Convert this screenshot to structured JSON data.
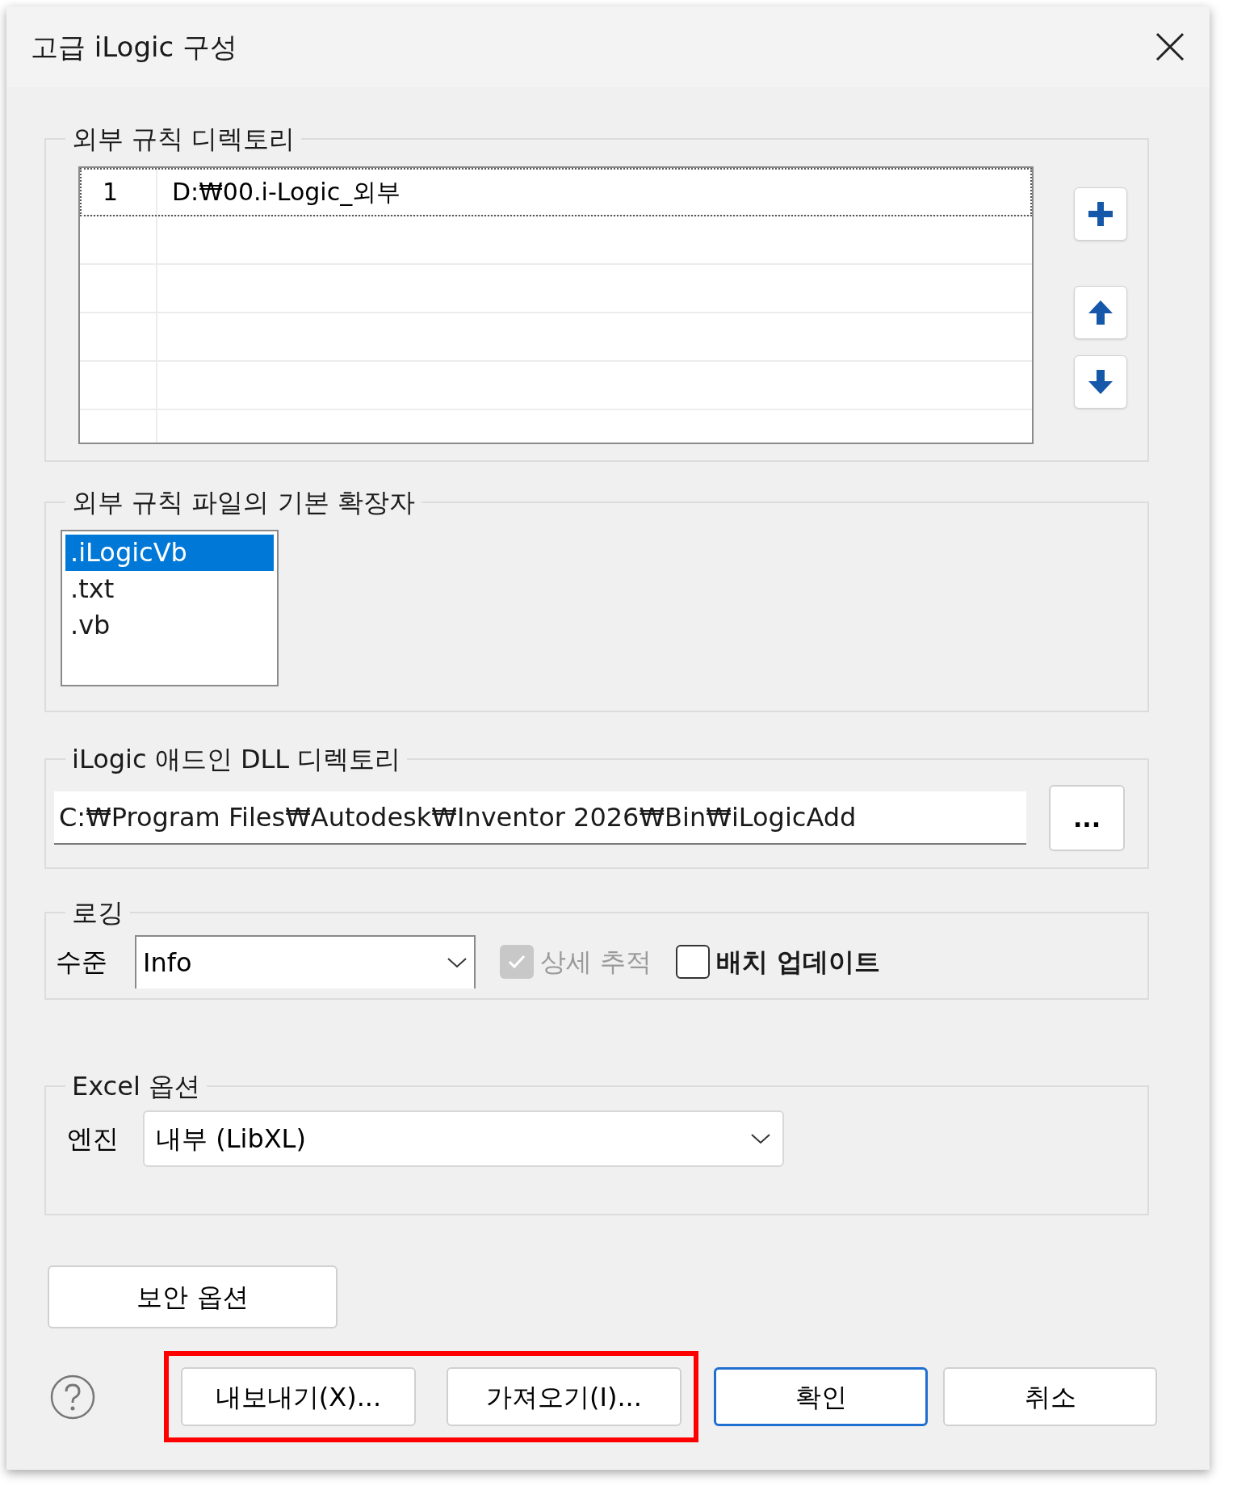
{
  "window": {
    "title": "고급 iLogic 구성"
  },
  "rules_directory": {
    "title": "외부 규칙 디렉토리",
    "rows": [
      {
        "index": "1",
        "path": "D:₩00.i-Logic_외부",
        "focused": true
      }
    ]
  },
  "extensions": {
    "title": "외부 규칙 파일의 기본 확장자",
    "items": [
      {
        "label": ".iLogicVb",
        "selected": true
      },
      {
        "label": ".txt",
        "selected": false
      },
      {
        "label": ".vb",
        "selected": false
      }
    ]
  },
  "addin_directory": {
    "title": "iLogic 애드인 DLL 디렉토리",
    "value": "C:₩Program Files₩Autodesk₩Inventor 2026₩Bin₩iLogicAdd",
    "browse": "..."
  },
  "logging": {
    "title": "로깅",
    "level_label": "수준",
    "level_value": "Info",
    "options": [
      {
        "label": "상세 추적",
        "checked": true,
        "disabled": true
      },
      {
        "label": "배치 업데이트",
        "checked": false,
        "disabled": false
      }
    ]
  },
  "excel": {
    "title": "Excel 옵션",
    "engine_label": "엔진",
    "engine_value": "내부 (LibXL)"
  },
  "security_button": "보안 옵션",
  "footer": {
    "buttons": [
      {
        "label": "내보내기(X)...",
        "highlighted": true,
        "default": false
      },
      {
        "label": "가져오기(I)...",
        "highlighted": true,
        "default": false
      },
      {
        "label": "확인",
        "highlighted": false,
        "default": true
      },
      {
        "label": "취소",
        "highlighted": false,
        "default": false
      }
    ]
  }
}
